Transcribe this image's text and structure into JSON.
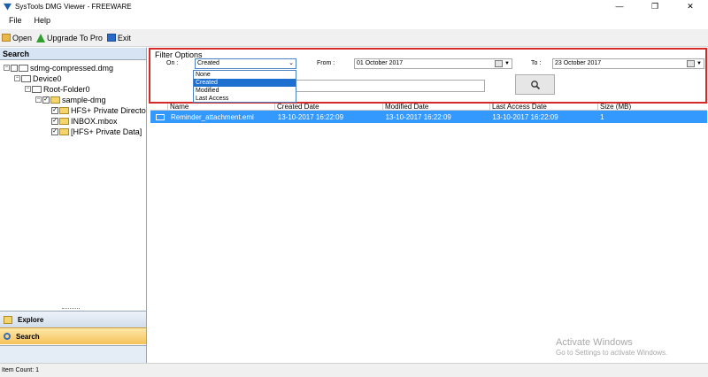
{
  "window": {
    "title": "SysTools DMG Viewer - FREEWARE",
    "minimize": "—",
    "maximize": "❐",
    "close": "✕"
  },
  "menu": {
    "file": "File",
    "help": "Help"
  },
  "toolbar": {
    "open": "Open",
    "upgrade": "Upgrade To Pro",
    "exit": "Exit"
  },
  "left_panel": {
    "header": "Search",
    "tree": [
      {
        "label": "sdmg-compressed.dmg"
      },
      {
        "label": "Device0"
      },
      {
        "label": "Root-Folder0"
      },
      {
        "label": "sample-dmg"
      },
      {
        "label": "HFS+ Private Directo"
      },
      {
        "label": "INBOX.mbox"
      },
      {
        "label": "[HFS+ Private Data]"
      }
    ],
    "nav": {
      "explore": "Explore",
      "search": "Search"
    }
  },
  "filter": {
    "title": "Filter Options",
    "on_label": "On :",
    "selected": "Created",
    "options": [
      "None",
      "Created",
      "Modified",
      "Last Access"
    ],
    "from_label": "From :",
    "from_date": "01  October  2017",
    "to_label": "To :",
    "to_date": "23  October  2017",
    "search_value": ""
  },
  "grid": {
    "columns": [
      "Name",
      "Created Date",
      "Modified Date",
      "Last Access Date",
      "Size (MB)"
    ],
    "rows": [
      {
        "name": "Reminder_attachment.eml",
        "created": "13-10-2017 16:22:09",
        "modified": "13-10-2017 16:22:09",
        "last_access": "13-10-2017 16:22:09",
        "size": "1"
      }
    ]
  },
  "status": {
    "item_count": "Item Count: 1"
  },
  "watermark": {
    "line1": "Activate Windows",
    "line2": "Go to Settings to activate Windows."
  }
}
